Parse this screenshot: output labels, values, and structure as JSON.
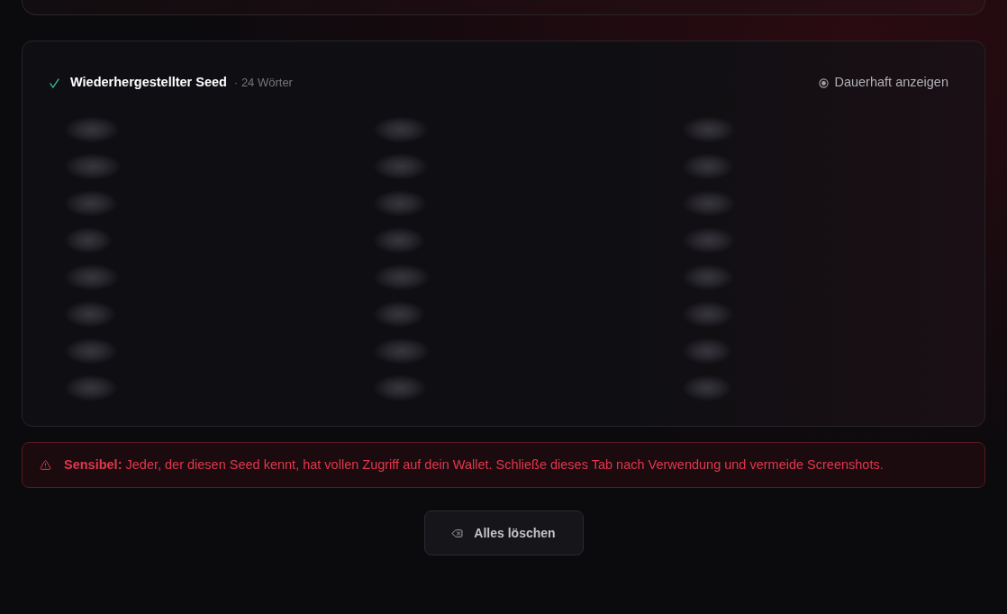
{
  "seed_card": {
    "title": "Wiederhergestellter Seed",
    "word_count": "· 24 Wörter",
    "reveal_toggle": {
      "label": "Dauerhaft anzeigen"
    },
    "words": [
      {
        "blurred": true
      },
      {
        "blurred": true
      },
      {
        "blurred": true
      },
      {
        "blurred": true
      },
      {
        "blurred": true
      },
      {
        "blurred": true
      },
      {
        "blurred": true
      },
      {
        "blurred": true
      },
      {
        "blurred": true
      },
      {
        "blurred": true
      },
      {
        "blurred": true
      },
      {
        "blurred": true
      },
      {
        "blurred": true
      },
      {
        "blurred": true
      },
      {
        "blurred": true
      },
      {
        "blurred": true
      },
      {
        "blurred": true
      },
      {
        "blurred": true
      },
      {
        "blurred": true
      },
      {
        "blurred": true
      },
      {
        "blurred": true
      },
      {
        "blurred": true
      },
      {
        "blurred": true
      },
      {
        "blurred": true
      }
    ]
  },
  "warning": {
    "text": "**Sensibel:** Jeder, der diesen Seed kennt, hat vollen Zugriff auf dein Wallet. Schließe dieses Tab nach Verwendung und vermeide Screenshots."
  },
  "clear_button": {
    "label": "Alles löschen"
  }
}
